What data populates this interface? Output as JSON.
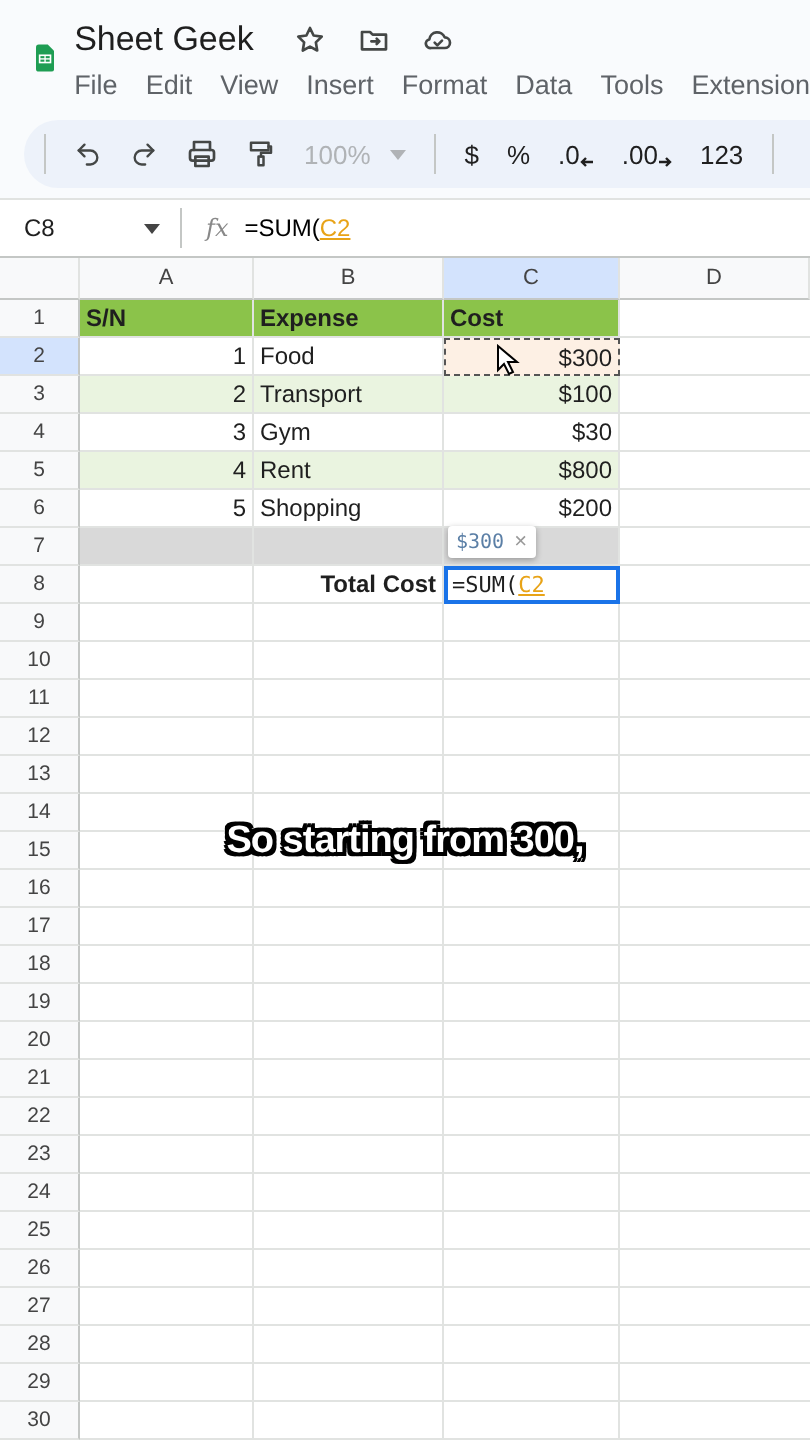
{
  "header": {
    "doc_title": "Sheet Geek",
    "menu": [
      {
        "label": "File"
      },
      {
        "label": "Edit"
      },
      {
        "label": "View"
      },
      {
        "label": "Insert"
      },
      {
        "label": "Format"
      },
      {
        "label": "Data"
      },
      {
        "label": "Tools"
      },
      {
        "label": "Extension"
      }
    ]
  },
  "toolbar": {
    "zoom": "100%",
    "zoom_disabled": true,
    "format_buttons": [
      {
        "label": "$",
        "kind": "plain"
      },
      {
        "label": "%",
        "kind": "plain"
      },
      {
        "label": ".0",
        "kind": "arrow_left"
      },
      {
        "label": ".00",
        "kind": "arrow_right"
      },
      {
        "label": "123",
        "kind": "plain"
      }
    ]
  },
  "formula_bar": {
    "cell_ref": "C8",
    "fx_label": "fx",
    "formula_prefix": "=SUM(",
    "formula_ref": "C2"
  },
  "columns": [
    {
      "label": "A",
      "selected": false
    },
    {
      "label": "B",
      "selected": false
    },
    {
      "label": "C",
      "selected": true
    },
    {
      "label": "D",
      "selected": false
    }
  ],
  "rows": [
    {
      "number": "1",
      "selected": false,
      "kind": "header",
      "cells": {
        "A": {
          "text": "S/N"
        },
        "B": {
          "text": "Expense"
        },
        "C": {
          "text": "Cost"
        }
      }
    },
    {
      "number": "2",
      "selected": true,
      "kind": "data",
      "banded": false,
      "cells": {
        "A": {
          "text": "1"
        },
        "B": {
          "text": "Food"
        },
        "C": {
          "text": "$300",
          "referenced": true
        }
      }
    },
    {
      "number": "3",
      "selected": false,
      "kind": "data",
      "banded": true,
      "cells": {
        "A": {
          "text": "2"
        },
        "B": {
          "text": "Transport"
        },
        "C": {
          "text": "$100",
          "referenced": false
        }
      }
    },
    {
      "number": "4",
      "selected": false,
      "kind": "data",
      "banded": false,
      "cells": {
        "A": {
          "text": "3"
        },
        "B": {
          "text": "Gym"
        },
        "C": {
          "text": "$30",
          "referenced": false
        }
      }
    },
    {
      "number": "5",
      "selected": false,
      "kind": "data",
      "banded": true,
      "cells": {
        "A": {
          "text": "4"
        },
        "B": {
          "text": "Rent"
        },
        "C": {
          "text": "$800",
          "referenced": false
        }
      }
    },
    {
      "number": "6",
      "selected": false,
      "kind": "data",
      "banded": false,
      "cells": {
        "A": {
          "text": "5"
        },
        "B": {
          "text": "Shopping"
        },
        "C": {
          "text": "$200",
          "referenced": false
        }
      }
    },
    {
      "number": "7",
      "selected": false,
      "kind": "divider",
      "cells": {
        "A": {
          "shaded": true
        },
        "B": {
          "shaded": true
        },
        "C": {
          "shaded": true
        }
      }
    },
    {
      "number": "8",
      "selected": false,
      "kind": "total",
      "cells": {
        "B": {
          "text": "Total Cost"
        },
        "C": {
          "kind": "editor",
          "prefix": "=SUM(",
          "ref": "C2",
          "hint_value": "$300",
          "hint_close": "×"
        }
      }
    },
    {
      "number": "9",
      "selected": false,
      "kind": "empty"
    },
    {
      "number": "10",
      "selected": false,
      "kind": "empty"
    },
    {
      "number": "11",
      "selected": false,
      "kind": "empty"
    },
    {
      "number": "12",
      "selected": false,
      "kind": "empty"
    },
    {
      "number": "13",
      "selected": false,
      "kind": "empty"
    },
    {
      "number": "14",
      "selected": false,
      "kind": "empty"
    },
    {
      "number": "15",
      "selected": false,
      "kind": "empty"
    },
    {
      "number": "16",
      "selected": false,
      "kind": "empty"
    },
    {
      "number": "17",
      "selected": false,
      "kind": "empty"
    },
    {
      "number": "18",
      "selected": false,
      "kind": "empty"
    },
    {
      "number": "19",
      "selected": false,
      "kind": "empty"
    },
    {
      "number": "20",
      "selected": false,
      "kind": "empty"
    },
    {
      "number": "21",
      "selected": false,
      "kind": "empty"
    },
    {
      "number": "22",
      "selected": false,
      "kind": "empty"
    },
    {
      "number": "23",
      "selected": false,
      "kind": "empty"
    },
    {
      "number": "24",
      "selected": false,
      "kind": "empty"
    },
    {
      "number": "25",
      "selected": false,
      "kind": "empty"
    },
    {
      "number": "26",
      "selected": false,
      "kind": "empty"
    },
    {
      "number": "27",
      "selected": false,
      "kind": "empty"
    },
    {
      "number": "28",
      "selected": false,
      "kind": "empty"
    },
    {
      "number": "29",
      "selected": false,
      "kind": "empty"
    },
    {
      "number": "30",
      "selected": false,
      "kind": "empty"
    }
  ],
  "caption": "So starting from 300,"
}
